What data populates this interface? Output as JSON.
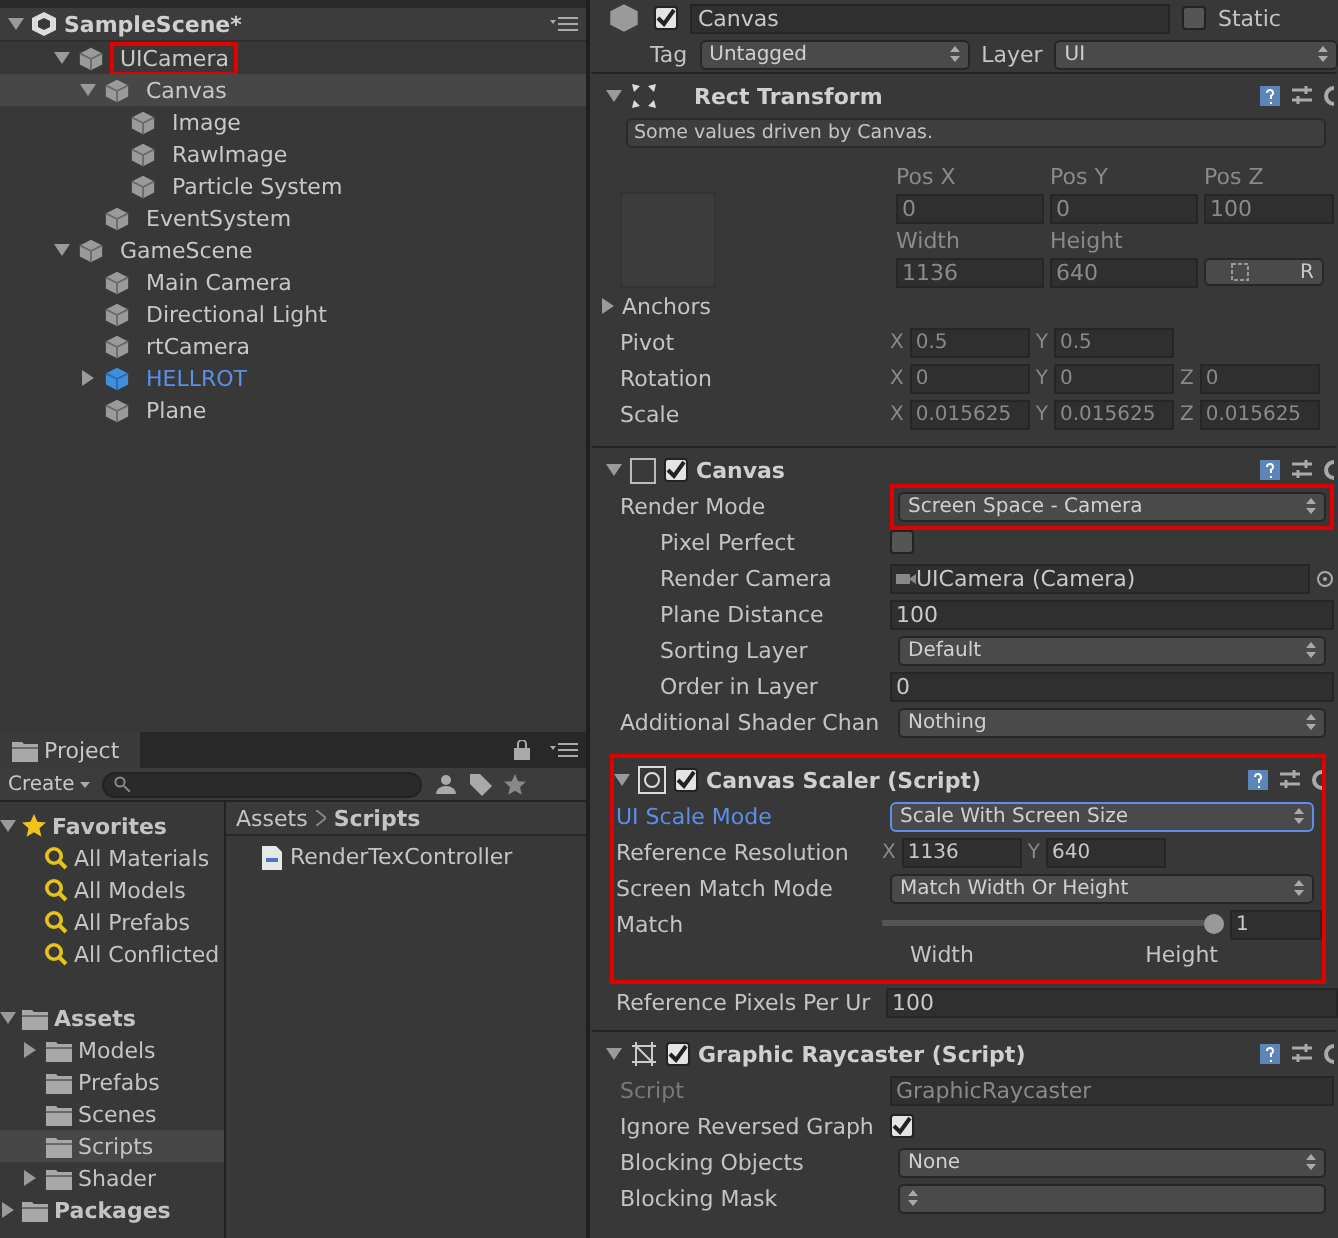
{
  "hierarchy": {
    "scene": "SampleScene*",
    "items": [
      {
        "label": "UICamera",
        "kind": "object",
        "selected": false,
        "highlighted": true,
        "expanded": true,
        "children": [
          {
            "label": "Canvas",
            "kind": "object",
            "selected": true,
            "highlighted": false,
            "expanded": true,
            "children": [
              {
                "label": "Image",
                "kind": "object",
                "selected": false,
                "highlighted": false
              },
              {
                "label": "RawImage",
                "kind": "object",
                "selected": false,
                "highlighted": false
              },
              {
                "label": "Particle System",
                "kind": "object",
                "selected": false,
                "highlighted": false
              }
            ]
          },
          {
            "label": "EventSystem",
            "kind": "object",
            "selected": false,
            "highlighted": false
          }
        ]
      },
      {
        "label": "GameScene",
        "kind": "object",
        "selected": false,
        "highlighted": false,
        "expanded": true,
        "children": [
          {
            "label": "Main Camera",
            "kind": "object",
            "selected": false,
            "highlighted": false
          },
          {
            "label": "Directional Light",
            "kind": "object",
            "selected": false,
            "highlighted": false
          },
          {
            "label": "rtCamera",
            "kind": "object",
            "selected": false,
            "highlighted": false
          },
          {
            "label": "HELLROT",
            "kind": "prefab",
            "selected": false,
            "highlighted": false,
            "expanded": false
          },
          {
            "label": "Plane",
            "kind": "object",
            "selected": false,
            "highlighted": false
          }
        ]
      }
    ]
  },
  "project": {
    "tab": "Project",
    "create": "Create",
    "favorites": {
      "label": "Favorites",
      "items": [
        "All Materials",
        "All Models",
        "All Prefabs",
        "All Conflicted"
      ]
    },
    "assets": {
      "label": "Assets",
      "children": [
        {
          "label": "Models",
          "expanded": false,
          "selected": false
        },
        {
          "label": "Prefabs",
          "selected": false
        },
        {
          "label": "Scenes",
          "selected": false
        },
        {
          "label": "Scripts",
          "selected": true
        },
        {
          "label": "Shader",
          "expanded": false,
          "selected": false
        }
      ]
    },
    "packages": "Packages",
    "breadcrumb": [
      "Assets",
      "Scripts"
    ],
    "files": [
      "RenderTexController"
    ]
  },
  "inspector": {
    "object": {
      "name": "Canvas",
      "active": true,
      "static_label": "Static",
      "static": false,
      "tag_label": "Tag",
      "tag": "Untagged",
      "layer_label": "Layer",
      "layer": "UI"
    },
    "components": [
      {
        "title": "Rect Transform",
        "kind": "rect_transform",
        "highlighted": false,
        "note": "Some values driven by Canvas.",
        "rows": [
          {
            "kind": "rect_grid",
            "disabled": true,
            "labels": [
              "Pos X",
              "Pos Y",
              "Pos Z"
            ],
            "values": [
              "0",
              "0",
              "100"
            ],
            "size_labels": [
              "Width",
              "Height"
            ],
            "size_values": [
              "1136",
              "640"
            ],
            "button": "R"
          },
          {
            "kind": "foldout",
            "label": "Anchors",
            "expanded": false
          },
          {
            "kind": "vector",
            "label": "Pivot",
            "disabled": true,
            "axes": [
              {
                "axis": "X",
                "value": "0.5"
              },
              {
                "axis": "Y",
                "value": "0.5"
              }
            ]
          },
          {
            "kind": "vector",
            "label": "Rotation",
            "disabled": true,
            "axes": [
              {
                "axis": "X",
                "value": "0"
              },
              {
                "axis": "Y",
                "value": "0"
              },
              {
                "axis": "Z",
                "value": "0"
              }
            ]
          },
          {
            "kind": "vector",
            "label": "Scale",
            "disabled": true,
            "axes": [
              {
                "axis": "X",
                "value": "0.015625"
              },
              {
                "axis": "Y",
                "value": "0.015625"
              },
              {
                "axis": "Z",
                "value": "0.015625"
              }
            ]
          }
        ]
      },
      {
        "title": "Canvas",
        "kind": "canvas",
        "enabled": true,
        "highlighted": false,
        "rows": [
          {
            "kind": "dropdown",
            "label": "Render Mode",
            "value": "Screen Space - Camera",
            "highlighted": true
          },
          {
            "kind": "checkbox",
            "label": "Pixel Perfect",
            "indent": true,
            "checked": false
          },
          {
            "kind": "object",
            "label": "Render Camera",
            "indent": true,
            "value": "UICamera (Camera)"
          },
          {
            "kind": "field",
            "label": "Plane Distance",
            "indent": true,
            "value": "100"
          },
          {
            "kind": "dropdown",
            "label": "Sorting Layer",
            "indent": true,
            "value": "Default"
          },
          {
            "kind": "field",
            "label": "Order in Layer",
            "indent": true,
            "value": "0"
          },
          {
            "kind": "dropdown",
            "label": "Additional Shader Chan",
            "value": "Nothing"
          }
        ]
      },
      {
        "title": "Canvas Scaler (Script)",
        "kind": "canvas_scaler",
        "enabled": true,
        "highlighted": true,
        "rows": [
          {
            "kind": "dropdown",
            "label": "UI Scale Mode",
            "value": "Scale With Screen Size",
            "focused": true
          },
          {
            "kind": "vector",
            "label": "Reference Resolution",
            "axes": [
              {
                "axis": "X",
                "value": "1136"
              },
              {
                "axis": "Y",
                "value": "640"
              }
            ]
          },
          {
            "kind": "dropdown",
            "label": "Screen Match Mode",
            "value": "Match Width Or Height"
          },
          {
            "kind": "slider",
            "label": "Match",
            "level": 1,
            "value": "1",
            "min_label": "Width",
            "max_label": "Height"
          }
        ],
        "after_rows": [
          {
            "kind": "field",
            "label": "Reference Pixels Per Ur",
            "value": "100"
          }
        ]
      },
      {
        "title": "Graphic Raycaster (Script)",
        "kind": "graphic_raycaster",
        "enabled": true,
        "highlighted": false,
        "rows": [
          {
            "kind": "script",
            "label": "Script",
            "disabled": true,
            "value": "GraphicRaycaster"
          },
          {
            "kind": "checkbox",
            "label": "Ignore Reversed Graph",
            "checked": true
          },
          {
            "kind": "dropdown",
            "label": "Blocking Objects",
            "value": "None"
          },
          {
            "kind": "dropdown",
            "label": "Blocking Mask"
          }
        ]
      }
    ]
  }
}
